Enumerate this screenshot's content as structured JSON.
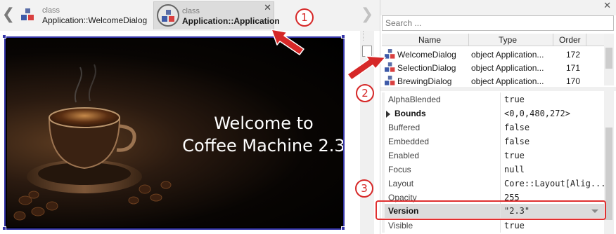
{
  "nav": {
    "back_glyph": "❮",
    "forward_glyph": "❯"
  },
  "tabs": [
    {
      "kind": "class",
      "name": "Application::WelcomeDialog",
      "icon": "class-icon",
      "active": false
    },
    {
      "kind": "class",
      "name": "Application::Application",
      "icon": "class-icon",
      "active": true,
      "close": "✕"
    }
  ],
  "canvas": {
    "welcome_text": "Welcome to\nCoffee Machine 2.3",
    "image": "coffee-cup-photo"
  },
  "panel": {
    "close": "✕",
    "search_placeholder": "Search ...",
    "columns": {
      "name": "Name",
      "type": "Type",
      "order": "Order"
    },
    "members": [
      {
        "name": "WelcomeDialog",
        "type": "object Application...",
        "order": "172",
        "icon": "class-icon"
      },
      {
        "name": "SelectionDialog",
        "type": "object Application...",
        "order": "171",
        "icon": "class-icon"
      },
      {
        "name": "BrewingDialog",
        "type": "object Application...",
        "order": "170",
        "icon": "class-icon"
      }
    ],
    "properties": [
      {
        "name": "AlphaBlended",
        "value": "true"
      },
      {
        "name": "Bounds",
        "value": "<0,0,480,272>",
        "expandable": true
      },
      {
        "name": "Buffered",
        "value": "false"
      },
      {
        "name": "Embedded",
        "value": "false"
      },
      {
        "name": "Enabled",
        "value": "true"
      },
      {
        "name": "Focus",
        "value": "null"
      },
      {
        "name": "Layout",
        "value": "Core::Layout[Alig..."
      },
      {
        "name": "Opacity",
        "value": "255"
      },
      {
        "name": "Version",
        "value": "\"2.3\"",
        "selected": true,
        "dropdown": true
      },
      {
        "name": "Visible",
        "value": "true"
      }
    ]
  },
  "annotations": {
    "callouts": [
      "1",
      "2",
      "3"
    ],
    "color": "#d62828"
  },
  "colors": {
    "selection_border": "#3535a8",
    "accent_red": "#d62828"
  }
}
